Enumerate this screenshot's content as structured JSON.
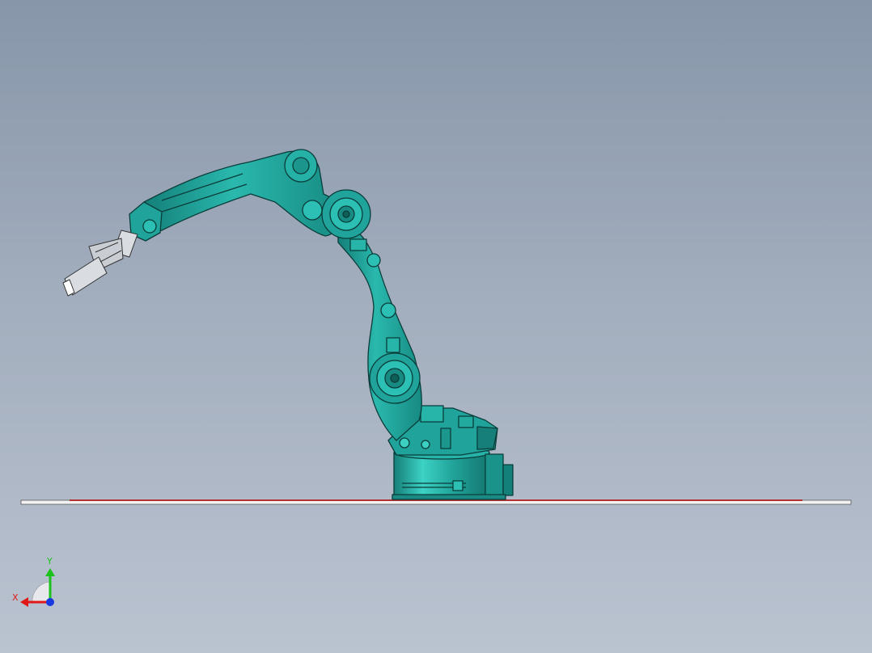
{
  "triad": {
    "x_label": "X",
    "y_label": "Y",
    "x_color": "#e01818",
    "y_color": "#1cc21c",
    "z_color": "#1838e0"
  },
  "colors": {
    "background_top": "#8796aa",
    "background_bottom": "#bac3d0",
    "robot_body": "#1fa39a",
    "robot_highlight": "#35c9bd",
    "robot_outline": "#0a3d3a",
    "gripper": "#d9dde2",
    "floor_plate": "#f2f2f2",
    "floor_edge": "#b03232"
  },
  "icons": {
    "robot": "industrial-robot-arm-model",
    "triad": "view-orientation-triad"
  }
}
